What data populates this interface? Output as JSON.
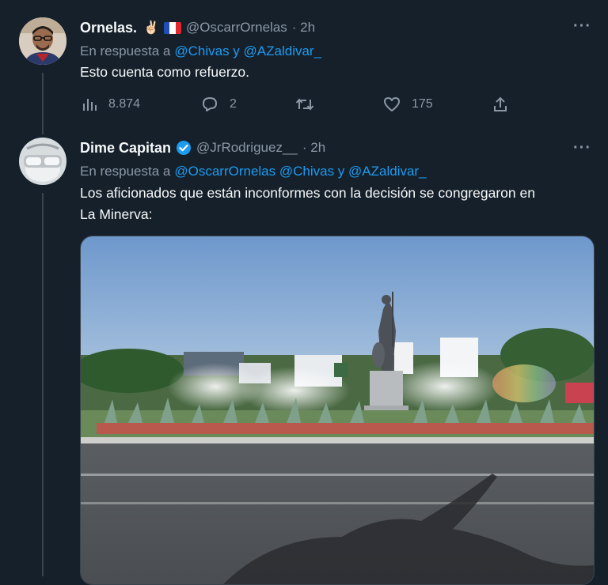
{
  "tweet1": {
    "name": "Ornelas.",
    "emoji": "✌🏻",
    "handle": "@OscarrOrnelas",
    "time": "· 2h",
    "reply_prefix": "En respuesta a",
    "reply_mentions": "@Chivas y @AZaldivar_",
    "text": "Esto cuenta como refuerzo.",
    "views": "8.874",
    "replies": "2",
    "retweets": "",
    "likes": "175",
    "more": "···"
  },
  "tweet2": {
    "name": "Dime Capitan",
    "handle": "@JrRodriguez__",
    "time": "· 2h",
    "reply_prefix": "En respuesta a",
    "reply_mentions": "@OscarrOrnelas @Chivas y @AZaldivar_",
    "text_line1": "Los aficionados que están inconformes con la decisión se congregaron en",
    "text_line2": "La Minerva:",
    "more": "···"
  },
  "colors": {
    "background": "#15202b",
    "text": "#f7f9f9",
    "muted": "#8b98a5",
    "accent": "#1d9bf0",
    "verified": "#1d9bf0"
  },
  "icons": [
    "views-icon",
    "reply-icon",
    "retweet-icon",
    "like-icon",
    "share-icon",
    "verified-icon",
    "france-flag-icon",
    "more-icon"
  ]
}
